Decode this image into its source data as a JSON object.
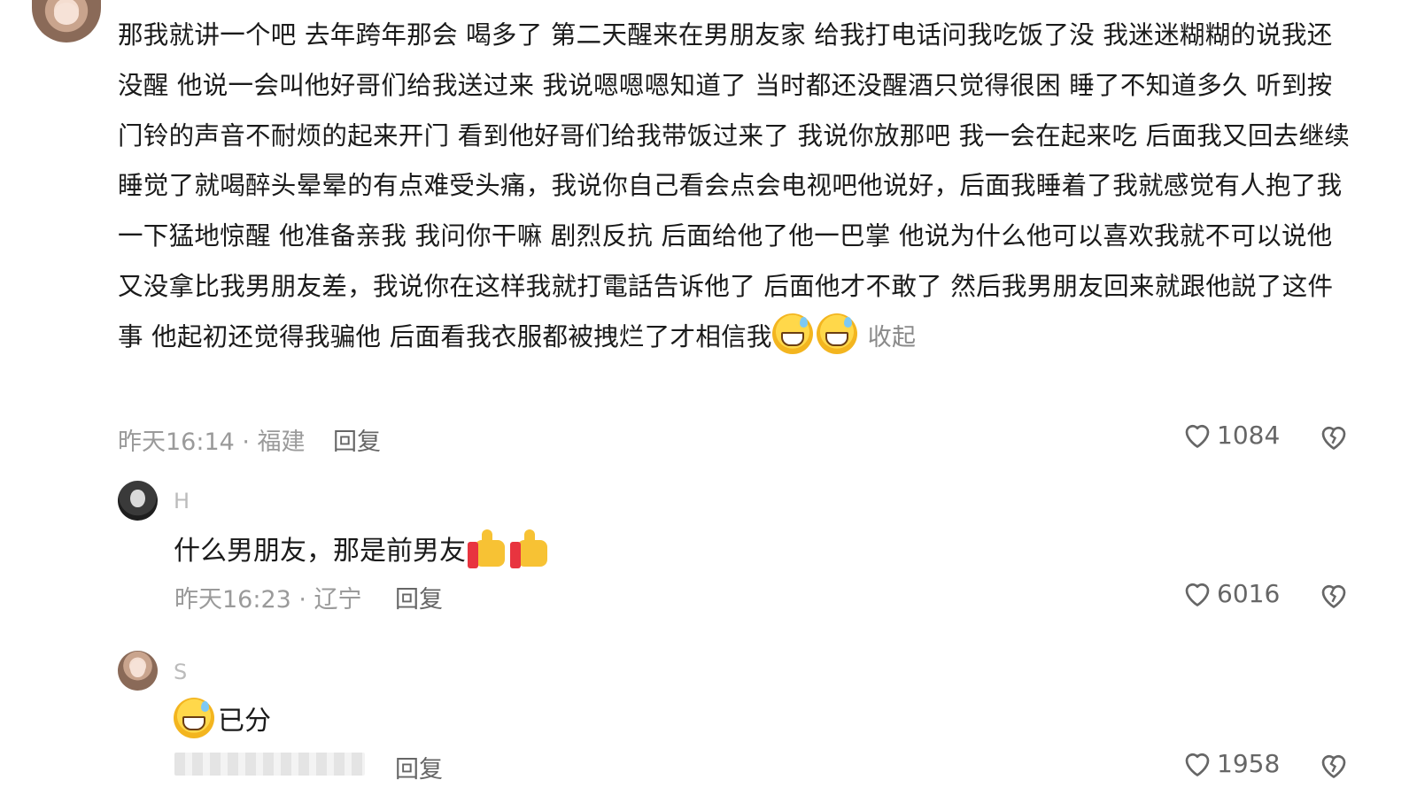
{
  "main_comment": {
    "text": "那我就讲一个吧 去年跨年那会 喝多了 第二天醒来在男朋友家 给我打电话问我吃饭了没 我迷迷糊糊的说我还没醒 他说一会叫他好哥们给我送过来 我说嗯嗯嗯知道了 当时都还没醒酒只觉得很困 睡了不知道多久 听到按门铃的声音不耐烦的起来开门 看到他好哥们给我带饭过来了 我说你放那吧 我一会在起来吃 后面我又回去继续睡觉了就喝醉头晕晕的有点难受头痛，我说你自己看会点会电视吧他说好，后面我睡着了我就感觉有人抱了我一下猛地惊醒 他准备亲我 我问你干嘛 剧烈反抗 后面给他了他一巴掌 他说为什么他可以喜欢我就不可以说他又没拿比我男朋友差，我说你在这样我就打電話告诉他了 后面他才不敢了 然后我男朋友回来就跟他説了这件事 他起初还觉得我骗他 后面看我衣服都被拽烂了才相信我",
    "collapse_label": "收起",
    "meta": "昨天16:14 · 福建",
    "reply_label": "回复",
    "likes": "1084"
  },
  "replies": [
    {
      "username": "H",
      "text": "什么男朋友，那是前男友",
      "meta": "昨天16:23 · 辽宁",
      "reply_label": "回复",
      "likes": "6016"
    },
    {
      "username": "S",
      "text": "已分",
      "meta": "",
      "reply_label": "回复",
      "likes": "1958"
    }
  ],
  "icons": {
    "like": "heart-outline-icon",
    "dislike": "broken-heart-icon"
  },
  "colors": {
    "text": "#1a1a1a",
    "meta": "#9a9a9a",
    "icon": "#666666"
  }
}
